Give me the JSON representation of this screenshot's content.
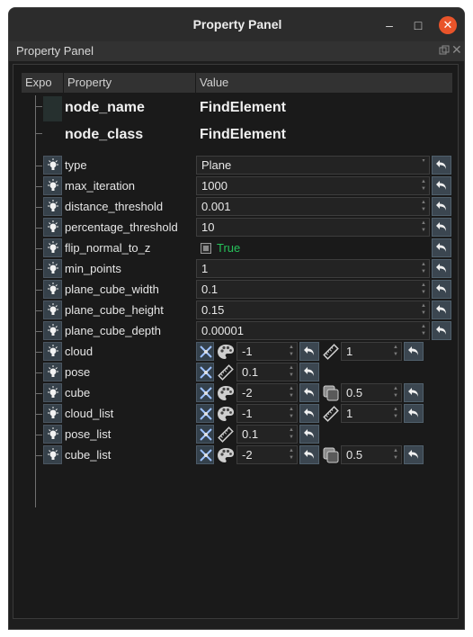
{
  "window": {
    "title": "Property Panel",
    "minimize_glyph": "–",
    "maximize_glyph": "□",
    "close_glyph": "✕"
  },
  "dock": {
    "title": "Property Panel",
    "float_icon": "float-icon",
    "close_icon": "close-icon"
  },
  "table": {
    "headers": {
      "expo": "Expo",
      "property": "Property",
      "value": "Value"
    }
  },
  "node": {
    "name_label": "node_name",
    "name_value": "FindElement",
    "class_label": "node_class",
    "class_value": "FindElement"
  },
  "properties": [
    {
      "name": "type",
      "value": "Plane"
    },
    {
      "name": "max_iteration",
      "value": "1000"
    },
    {
      "name": "distance_threshold",
      "value": "0.001"
    },
    {
      "name": "percentage_threshold",
      "value": "10"
    },
    {
      "name": "flip_normal_to_z",
      "value": "True"
    },
    {
      "name": "min_points",
      "value": "1"
    },
    {
      "name": "plane_cube_width",
      "value": "0.1"
    },
    {
      "name": "plane_cube_height",
      "value": "0.15"
    },
    {
      "name": "plane_cube_depth",
      "value": "0.00001"
    }
  ],
  "visuals": [
    {
      "name": "cloud",
      "color_value": "-1",
      "size_value": "1"
    },
    {
      "name": "pose",
      "size_value": "0.1"
    },
    {
      "name": "cube",
      "color_value": "-2",
      "alpha_value": "0.5"
    },
    {
      "name": "cloud_list",
      "color_value": "-1",
      "size_value": "1"
    },
    {
      "name": "pose_list",
      "size_value": "0.1"
    },
    {
      "name": "cube_list",
      "color_value": "-2",
      "alpha_value": "0.5"
    }
  ],
  "colors": {
    "true_text": "#26c15a",
    "close_button": "#e9542a",
    "reset_button": "#3b4650"
  }
}
